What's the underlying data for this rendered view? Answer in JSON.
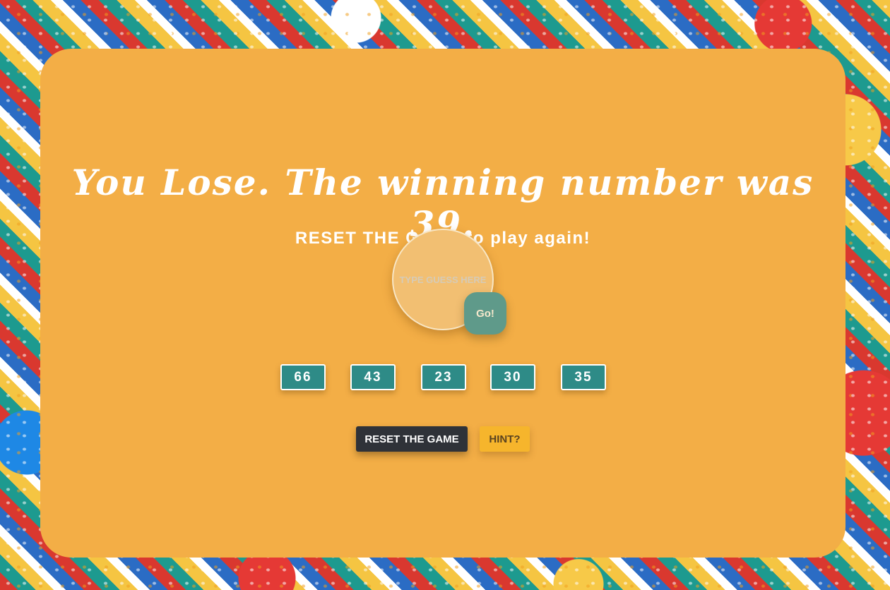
{
  "game": {
    "result_message": "You Lose. The winning number was 39.",
    "instruction": "RESET THE GAME to play again!",
    "guess_placeholder": "TYPE GUESS HERE",
    "go_label": "Go!",
    "previous_guesses": [
      "66",
      "43",
      "23",
      "30",
      "35"
    ],
    "reset_label": "RESET THE GAME",
    "hint_label": "HINT?"
  },
  "colors": {
    "card_background": "#f3ae46",
    "guess_chip": "#2e8b87",
    "go_button": "#5f9a8a",
    "reset_button": "#2f3238",
    "hint_button": "#f6b52c"
  }
}
